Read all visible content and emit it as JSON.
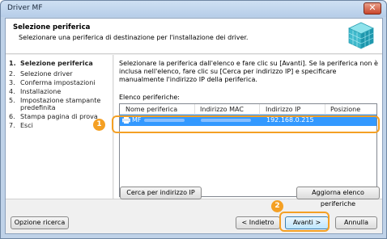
{
  "window": {
    "title": "Driver MF",
    "close_glyph": "✕"
  },
  "header": {
    "title": "Selezione periferica",
    "subtitle": "Selezionare una periferica di destinazione per l'installazione dei driver.",
    "icon": "cube-icon"
  },
  "steps": [
    {
      "num": "1.",
      "label": "Selezione periferica",
      "active": true
    },
    {
      "num": "2.",
      "label": "Selezione driver"
    },
    {
      "num": "3.",
      "label": "Conferma impostazioni"
    },
    {
      "num": "4.",
      "label": "Installazione"
    },
    {
      "num": "5.",
      "label": "Impostazione stampante"
    },
    {
      "num": "",
      "label": "predefinita"
    },
    {
      "num": "6.",
      "label": "Stampa pagina di prova"
    },
    {
      "num": "7.",
      "label": "Esci"
    }
  ],
  "content": {
    "instructions": "Selezionare la periferica dall'elenco e fare clic su [Avanti]. Se la periferica non è inclusa nell'elenco, fare clic su [Cerca per indirizzo IP] e specificare manualmente l'indirizzo IP della periferica.",
    "list_label": "Elenco periferiche:",
    "columns": [
      "Nome periferica",
      "Indirizzo MAC",
      "Indirizzo IP",
      "Posizione"
    ],
    "rows": [
      {
        "name": "MF",
        "mac": "",
        "ip": "192.168.0.215",
        "location": ""
      }
    ],
    "search_ip_button": "Cerca per indirizzo IP",
    "refresh_button": "Aggiorna elenco periferiche"
  },
  "callouts": {
    "one": "1",
    "two": "2"
  },
  "footer": {
    "search_option": "Opzione ricerca",
    "back": "< Indietro",
    "next": "Avanti >",
    "cancel": "Annulla"
  },
  "colors": {
    "accent_orange": "#f4a024",
    "selection_blue": "#3399ff"
  }
}
